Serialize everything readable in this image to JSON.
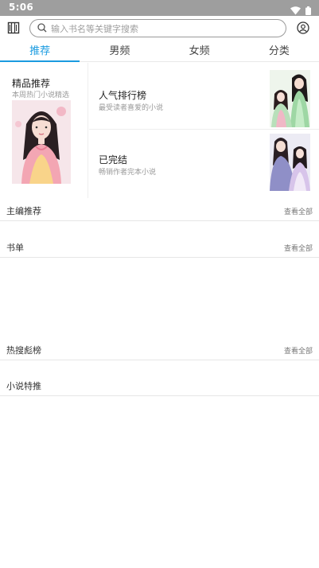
{
  "status_bar": {
    "time": "5:06"
  },
  "search": {
    "placeholder": "输入书名等关键字搜索"
  },
  "tabs": [
    {
      "label": "推荐",
      "active": true
    },
    {
      "label": "男频",
      "active": false
    },
    {
      "label": "女频",
      "active": false
    },
    {
      "label": "分类",
      "active": false
    }
  ],
  "featured": {
    "title": "精品推荐",
    "subtitle": "本周热门小说精选"
  },
  "rankings": [
    {
      "title": "人气排行榜",
      "subtitle": "最受读者喜爱的小说"
    },
    {
      "title": "已完结",
      "subtitle": "畅销作者完本小说"
    }
  ],
  "sections": [
    {
      "title": "主编推荐",
      "more": "查看全部"
    },
    {
      "title": "书单",
      "more": "查看全部"
    },
    {
      "title": "热搜彪榜",
      "more": "查看全部"
    },
    {
      "title": "小说特推"
    }
  ],
  "colors": {
    "accent": "#1a9be0",
    "status_bar": "#9e9e9e"
  }
}
